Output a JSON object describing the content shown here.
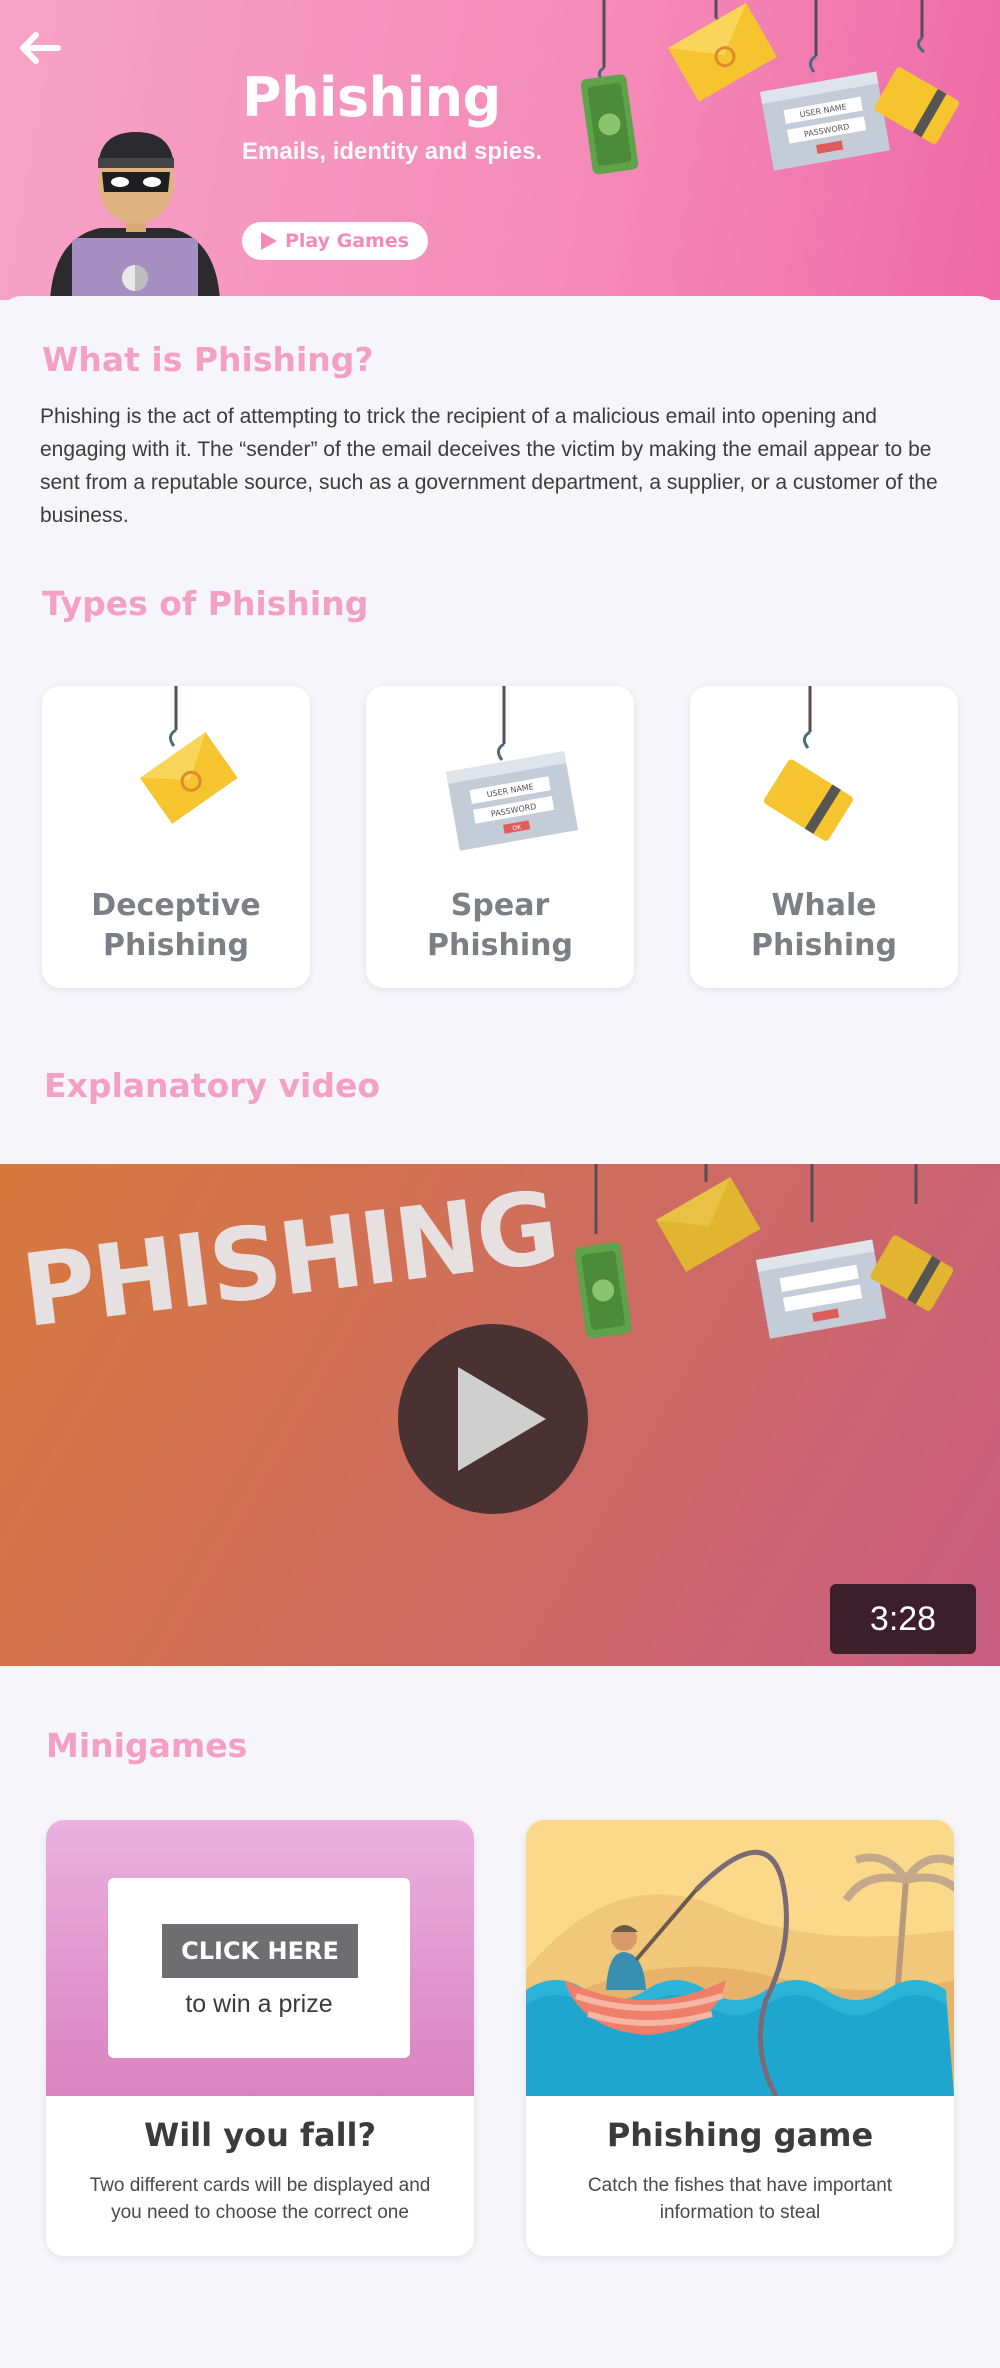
{
  "header": {
    "title": "Phishing",
    "subtitle": "Emails, identity and spies.",
    "play_games_label": "Play Games",
    "hanging_labels": {
      "user_name": "USER NAME",
      "password": "PASSWORD",
      "ok": "OK"
    }
  },
  "intro": {
    "title": "What is Phishing?",
    "body": "Phishing is the act of attempting to trick the recipient of a malicious email into opening and engaging with it. The “sender” of the email deceives the victim by making the email appear to be sent from a reputable source, such as a government department, a supplier, or a customer of the business."
  },
  "types": {
    "title": "Types of Phishing",
    "items": [
      {
        "line1": "Deceptive",
        "line2": "Phishing",
        "icon": "envelope-icon"
      },
      {
        "line1": "Spear",
        "line2": "Phishing",
        "icon": "login-form-icon"
      },
      {
        "line1": "Whale",
        "line2": "Phishing",
        "icon": "credit-card-icon"
      }
    ]
  },
  "video": {
    "title": "Explanatory video",
    "word": "PHISHING",
    "duration": "3:28"
  },
  "minigames": {
    "title": "Minigames",
    "items": [
      {
        "title": "Will you fall?",
        "description": "Two different cards will be displayed and you need to choose the correct one",
        "click_here": "CLICK HERE",
        "prize_text": "to win a prize"
      },
      {
        "title": "Phishing game",
        "description": "Catch the fishes that have important information to steal"
      }
    ]
  },
  "colors": {
    "accent_pink": "#f4a0c4",
    "header_pink": "#f48ab8",
    "card_gray_text": "#7d7f86"
  }
}
